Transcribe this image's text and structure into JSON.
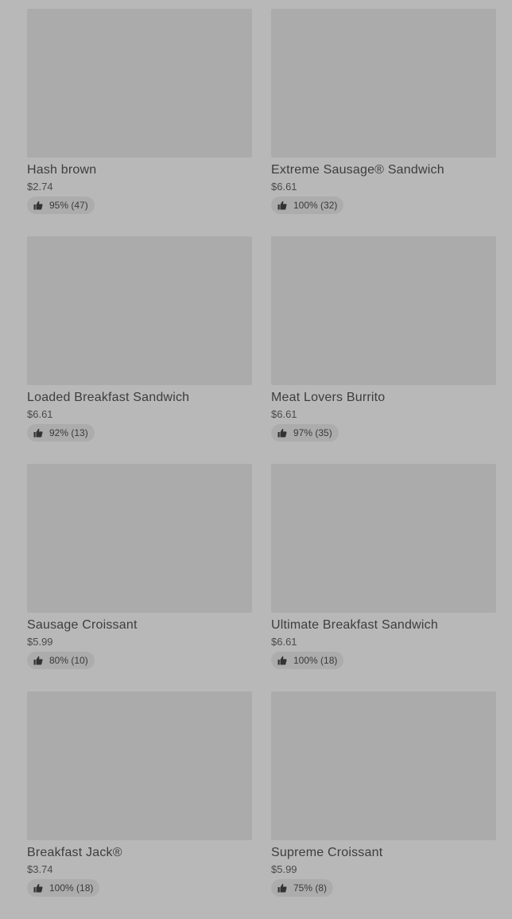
{
  "menu": {
    "items": [
      {
        "name": "Hash brown",
        "price": "$2.74",
        "rating": "95% (47)"
      },
      {
        "name": "Extreme Sausage® Sandwich",
        "price": "$6.61",
        "rating": "100% (32)"
      },
      {
        "name": "Loaded Breakfast Sandwich",
        "price": "$6.61",
        "rating": "92% (13)"
      },
      {
        "name": "Meat Lovers Burrito",
        "price": "$6.61",
        "rating": "97% (35)"
      },
      {
        "name": "Sausage Croissant",
        "price": "$5.99",
        "rating": "80% (10)"
      },
      {
        "name": "Ultimate Breakfast Sandwich",
        "price": "$6.61",
        "rating": "100% (18)"
      },
      {
        "name": "Breakfast Jack®",
        "price": "$3.74",
        "rating": "100% (18)"
      },
      {
        "name": "Supreme Croissant",
        "price": "$5.99",
        "rating": "75% (8)"
      }
    ]
  },
  "icons": {
    "rating": "thumbs-up-icon"
  },
  "colors": {
    "background": "#b8b8b8",
    "image_placeholder": "#ababab",
    "rating_pill": "#acacac",
    "text": "#3a3a3a"
  }
}
